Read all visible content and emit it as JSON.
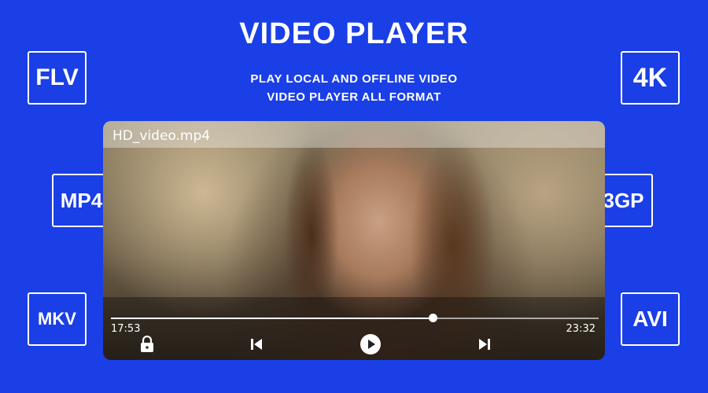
{
  "header": {
    "title": "VIDEO PLAYER",
    "subtitle_line1": "PLAY LOCAL AND OFFLINE VIDEO",
    "subtitle_line2": "VIDEO PLAYER ALL FORMAT"
  },
  "format_badges": {
    "left": [
      "FLV",
      "MP4",
      "MKV"
    ],
    "right": [
      "4K",
      "3GP",
      "AVI"
    ]
  },
  "player": {
    "filename": "HD_video.mp4",
    "current_time": "17:53",
    "duration": "23:32",
    "progress_fraction": 0.66,
    "icons": [
      "lock-icon",
      "previous-icon",
      "play-icon",
      "next-icon"
    ]
  },
  "colors": {
    "background": "#1a3fe6",
    "foreground": "#ffffff"
  }
}
